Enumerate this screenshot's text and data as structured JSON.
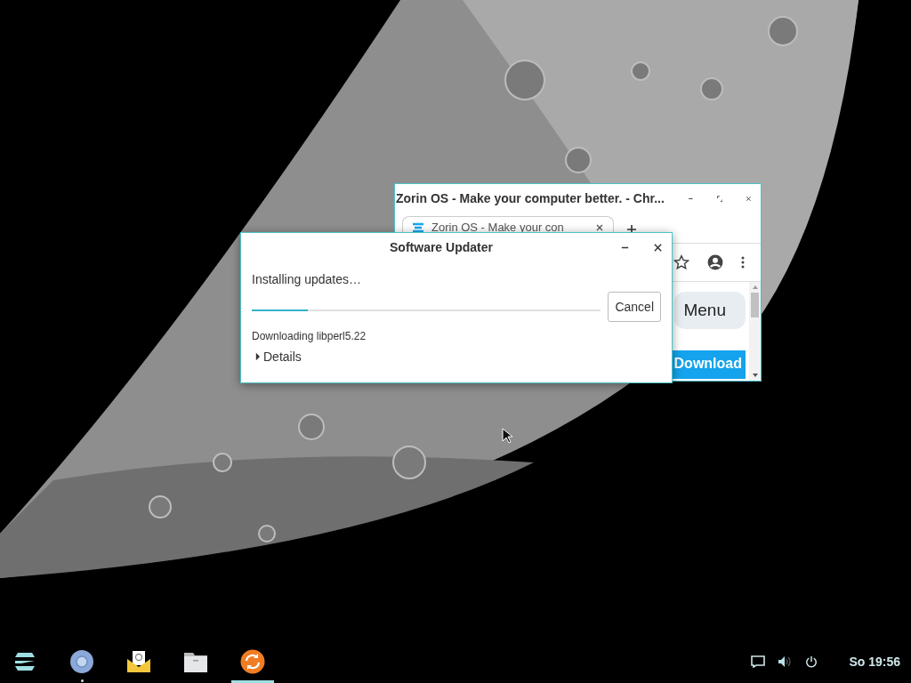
{
  "browser_window": {
    "title": "Zorin OS - Make your computer better. - Chr...",
    "tabs": [
      {
        "label": "Zorin OS - Make your con",
        "selected": true
      }
    ],
    "page_buttons": [
      {
        "label": "Menu",
        "kind": "secondary"
      },
      {
        "label": "Download",
        "kind": "primary"
      }
    ]
  },
  "updater_window": {
    "title": "Software Updater",
    "status": "Installing updates…",
    "progress": {
      "level": 0.16
    },
    "cancel_button": "Cancel",
    "detail": "Downloading libperl5.22",
    "details_expander": {
      "label": "Details",
      "expanded": false
    }
  },
  "taskbar": {
    "apps": [
      {
        "kind": "menu",
        "running": false,
        "selected": false
      },
      {
        "kind": "browser",
        "running": true,
        "selected": false
      },
      {
        "kind": "mail",
        "running": false,
        "selected": false
      },
      {
        "kind": "files",
        "running": false,
        "selected": false
      },
      {
        "kind": "updater",
        "running": true,
        "selected": true
      }
    ],
    "clock": "So 19:56"
  }
}
